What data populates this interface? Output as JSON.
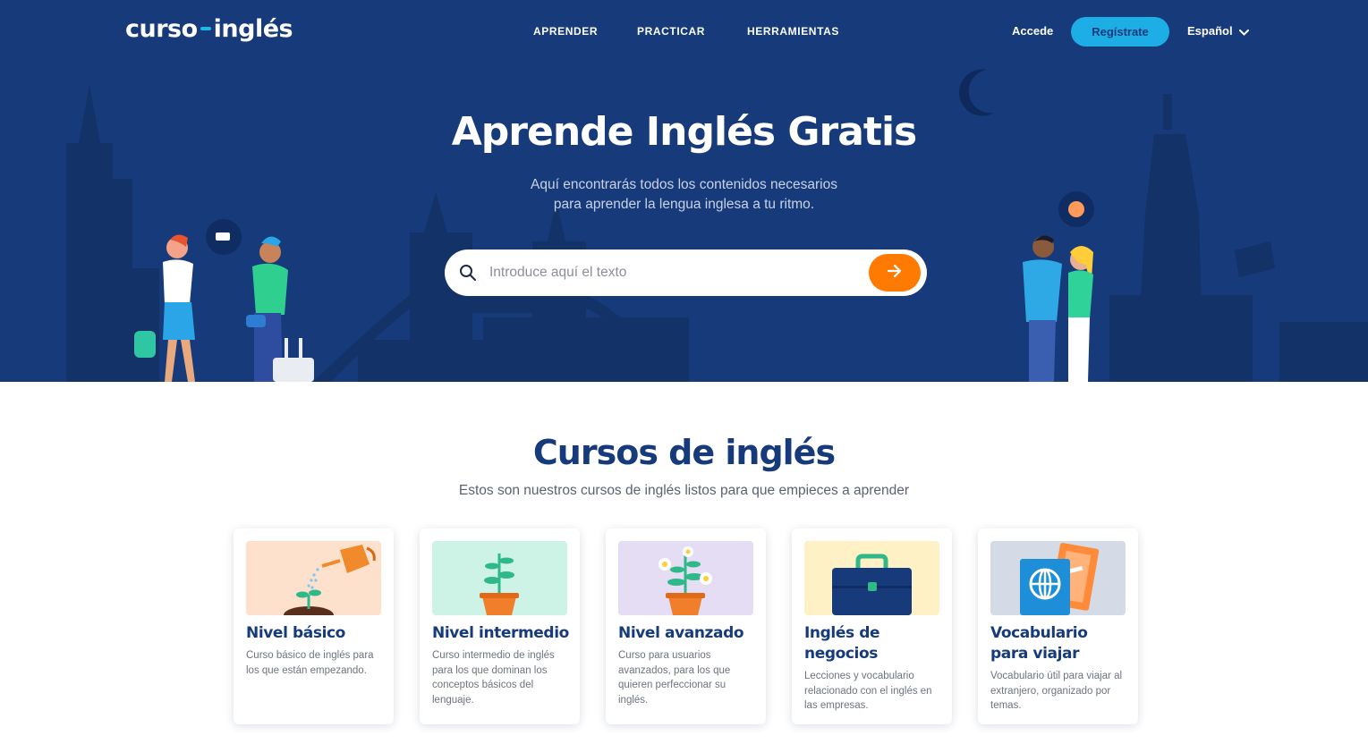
{
  "header": {
    "logo_left": "curso",
    "logo_right": "inglés",
    "nav": [
      "APRENDER",
      "PRACTICAR",
      "HERRAMIENTAS"
    ],
    "login": "Accede",
    "register": "Regístrate",
    "language": "Español"
  },
  "hero": {
    "title": "Aprende Inglés Gratis",
    "subtitle_line1": "Aquí encontrarás todos los contenidos necesarios",
    "subtitle_line2": "para aprender la lengua inglesa a tu ritmo.",
    "search_placeholder": "Introduce aquí el texto"
  },
  "courses": {
    "title": "Cursos de inglés",
    "subtitle": "Estos son nuestros cursos de inglés listos para que empieces a aprender",
    "items": [
      {
        "title": "Nivel básico",
        "description": "Curso básico de inglés para los que están empezando.",
        "bg": "#fde1cc"
      },
      {
        "title": "Nivel intermedio",
        "description": "Curso intermedio de inglés para los que dominan los conceptos básicos del lenguaje.",
        "bg": "#cdf3e6"
      },
      {
        "title": "Nivel avanzado",
        "description": "Curso para usuarios avanzados, para los que quieren perfeccionar su inglés.",
        "bg": "#e4ddf3"
      },
      {
        "title": "Inglés de negocios",
        "description": "Lecciones y vocabulario relacionado con el inglés en las empresas.",
        "bg": "#fdf1c5"
      },
      {
        "title": "Vocabulario para viajar",
        "description": "Vocabulario útil para viajar al extranjero, organizado por temas.",
        "bg": "#d4dae6"
      }
    ]
  },
  "colors": {
    "hero_bg": "#163a7a",
    "accent_blue": "#1eaee6",
    "accent_orange": "#ff7a00",
    "title_navy": "#163a7a"
  },
  "icons": [
    "search-icon",
    "arrow-right-icon",
    "chevron-down-icon",
    "moon-icon"
  ]
}
